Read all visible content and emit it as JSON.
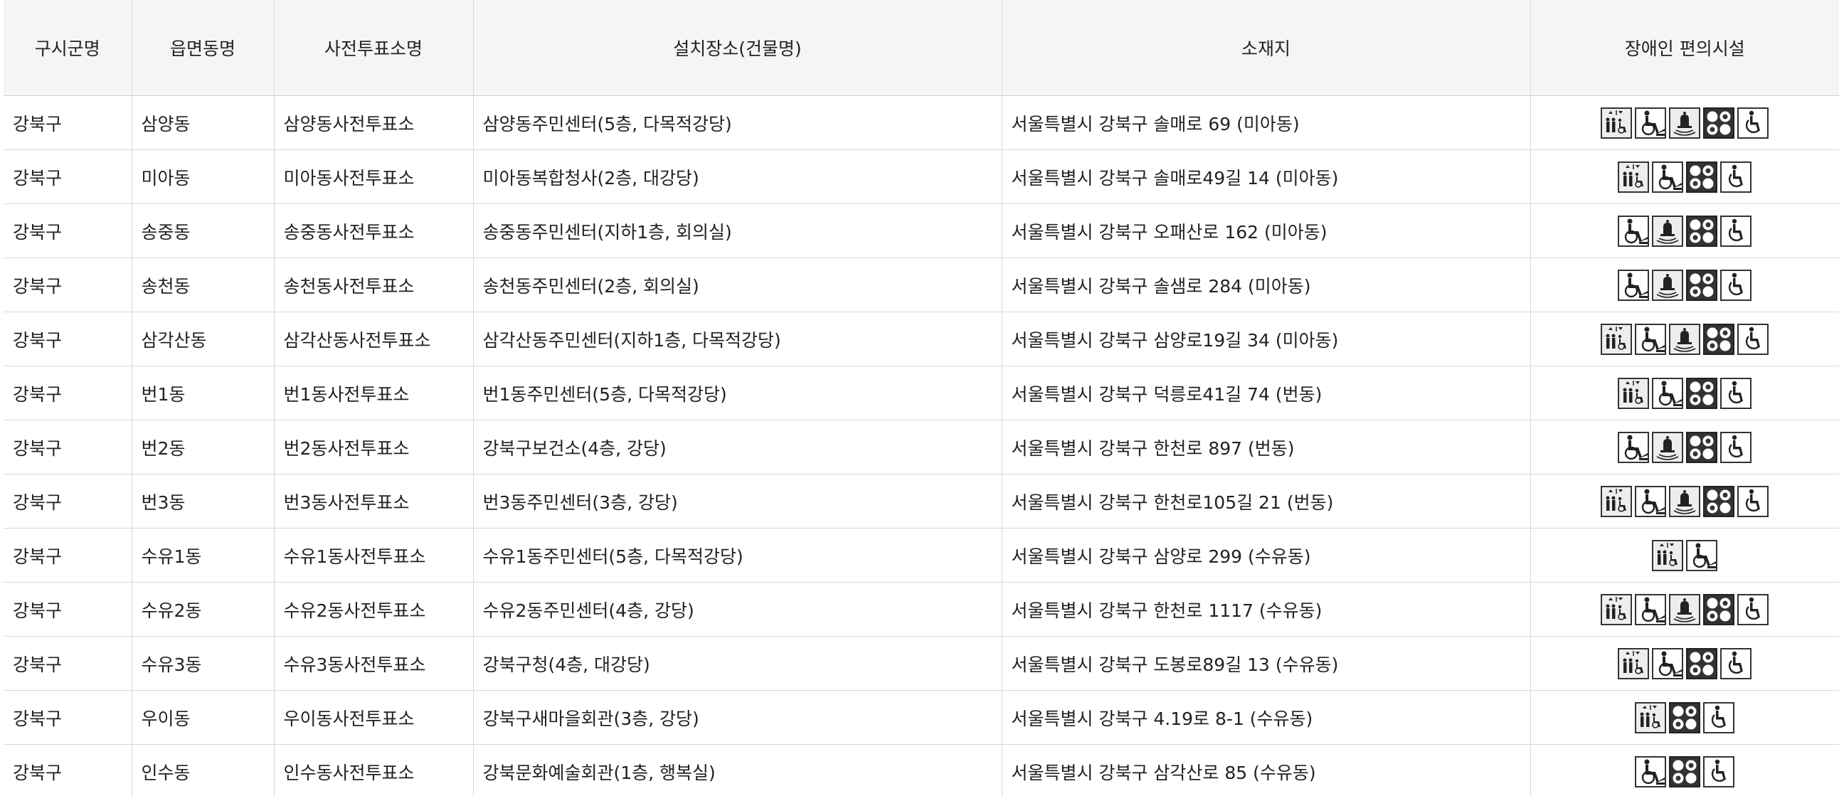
{
  "table": {
    "headers": [
      "구시군명",
      "읍면동명",
      "사전투표소명",
      "설치장소(건물명)",
      "소재지",
      "장애인 편의시설"
    ],
    "rows": [
      {
        "sigungu": "강북구",
        "dong": "삼양동",
        "station": "삼양동사전투표소",
        "place": "삼양동주민센터(5층, 다목적강당)",
        "address": "서울특별시 강북구 솔매로 69 (미아동)",
        "facilities": [
          "elevator-icon",
          "wheelchair-icon",
          "bell-icon",
          "braille-icon",
          "accessible-icon"
        ]
      },
      {
        "sigungu": "강북구",
        "dong": "미아동",
        "station": "미아동사전투표소",
        "place": "미아동복합청사(2층, 대강당)",
        "address": "서울특별시 강북구 솔매로49길 14 (미아동)",
        "facilities": [
          "elevator-icon",
          "wheelchair-icon",
          "braille-icon",
          "accessible-icon"
        ]
      },
      {
        "sigungu": "강북구",
        "dong": "송중동",
        "station": "송중동사전투표소",
        "place": "송중동주민센터(지하1층, 회의실)",
        "address": "서울특별시 강북구 오패산로 162 (미아동)",
        "facilities": [
          "wheelchair-icon",
          "bell-icon",
          "braille-icon",
          "accessible-icon"
        ]
      },
      {
        "sigungu": "강북구",
        "dong": "송천동",
        "station": "송천동사전투표소",
        "place": "송천동주민센터(2층, 회의실)",
        "address": "서울특별시 강북구 솔샘로 284 (미아동)",
        "facilities": [
          "wheelchair-icon",
          "bell-icon",
          "braille-icon",
          "accessible-icon"
        ]
      },
      {
        "sigungu": "강북구",
        "dong": "삼각산동",
        "station": "삼각산동사전투표소",
        "place": "삼각산동주민센터(지하1층, 다목적강당)",
        "address": "서울특별시 강북구 삼양로19길 34 (미아동)",
        "facilities": [
          "elevator-icon",
          "wheelchair-icon",
          "bell-icon",
          "braille-icon",
          "accessible-icon"
        ]
      },
      {
        "sigungu": "강북구",
        "dong": "번1동",
        "station": "번1동사전투표소",
        "place": "번1동주민센터(5층, 다목적강당)",
        "address": "서울특별시 강북구 덕릉로41길 74 (번동)",
        "facilities": [
          "elevator-icon",
          "wheelchair-icon",
          "braille-icon",
          "accessible-icon"
        ]
      },
      {
        "sigungu": "강북구",
        "dong": "번2동",
        "station": "번2동사전투표소",
        "place": "강북구보건소(4층, 강당)",
        "address": "서울특별시 강북구 한천로 897 (번동)",
        "facilities": [
          "wheelchair-icon",
          "bell-icon",
          "braille-icon",
          "accessible-icon"
        ]
      },
      {
        "sigungu": "강북구",
        "dong": "번3동",
        "station": "번3동사전투표소",
        "place": "번3동주민센터(3층, 강당)",
        "address": "서울특별시 강북구 한천로105길 21 (번동)",
        "facilities": [
          "elevator-icon",
          "wheelchair-icon",
          "bell-icon",
          "braille-icon",
          "accessible-icon"
        ]
      },
      {
        "sigungu": "강북구",
        "dong": "수유1동",
        "station": "수유1동사전투표소",
        "place": "수유1동주민센터(5층, 다목적강당)",
        "address": "서울특별시 강북구 삼양로 299 (수유동)",
        "facilities": [
          "elevator-icon",
          "wheelchair-icon"
        ]
      },
      {
        "sigungu": "강북구",
        "dong": "수유2동",
        "station": "수유2동사전투표소",
        "place": "수유2동주민센터(4층, 강당)",
        "address": "서울특별시 강북구 한천로 1117 (수유동)",
        "facilities": [
          "elevator-icon",
          "wheelchair-icon",
          "bell-icon",
          "braille-icon",
          "accessible-icon"
        ]
      },
      {
        "sigungu": "강북구",
        "dong": "수유3동",
        "station": "수유3동사전투표소",
        "place": "강북구청(4층, 대강당)",
        "address": "서울특별시 강북구 도봉로89길 13 (수유동)",
        "facilities": [
          "elevator-icon",
          "wheelchair-icon",
          "braille-icon",
          "accessible-icon"
        ]
      },
      {
        "sigungu": "강북구",
        "dong": "우이동",
        "station": "우이동사전투표소",
        "place": "강북구새마을회관(3층, 강당)",
        "address": "서울특별시 강북구 4.19로 8-1 (수유동)",
        "facilities": [
          "elevator-icon",
          "braille-icon",
          "accessible-icon"
        ]
      },
      {
        "sigungu": "강북구",
        "dong": "인수동",
        "station": "인수동사전투표소",
        "place": "강북문화예술회관(1층, 행복실)",
        "address": "서울특별시 강북구 삼각산로 85 (수유동)",
        "facilities": [
          "wheelchair-icon",
          "braille-icon",
          "accessible-icon"
        ]
      }
    ]
  }
}
